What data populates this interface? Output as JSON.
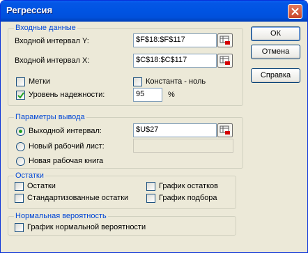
{
  "dialog": {
    "title": "Регрессия"
  },
  "input_group": {
    "title": "Входные данные",
    "y_label": "Входной интервал Y:",
    "y_value": "$F$18:$F$117",
    "x_label": "Входной интервал X:",
    "x_value": "$C$18:$C$117",
    "labels_label": "Метки",
    "labels_checked": false,
    "constant_label": "Константа - ноль",
    "constant_checked": false,
    "confidence_label": "Уровень надежности:",
    "confidence_checked": true,
    "confidence_value": "95",
    "percent": "%"
  },
  "output_group": {
    "title": "Параметры вывода",
    "output_range_label": "Выходной интервал:",
    "output_range_value": "$U$27",
    "new_sheet_label": "Новый рабочий лист:",
    "new_sheet_value": "",
    "new_workbook_label": "Новая рабочая книга",
    "selected": "output_range"
  },
  "residuals_group": {
    "title": "Остатки",
    "residuals_label": "Остатки",
    "std_residuals_label": "Стандартизованные остатки",
    "residual_plot_label": "График остатков",
    "fit_plot_label": "График подбора"
  },
  "probability_group": {
    "title": "Нормальная вероятность",
    "normal_plot_label": "График нормальной вероятности"
  },
  "buttons": {
    "ok": "ОК",
    "cancel": "Отмена",
    "help": "Справка"
  },
  "colors": {
    "titlebar": "#0054e3",
    "group_title": "#0046d5",
    "dialog_bg": "#ece9d8",
    "radio_dot": "#21a121",
    "check_mark": "#21a121"
  }
}
